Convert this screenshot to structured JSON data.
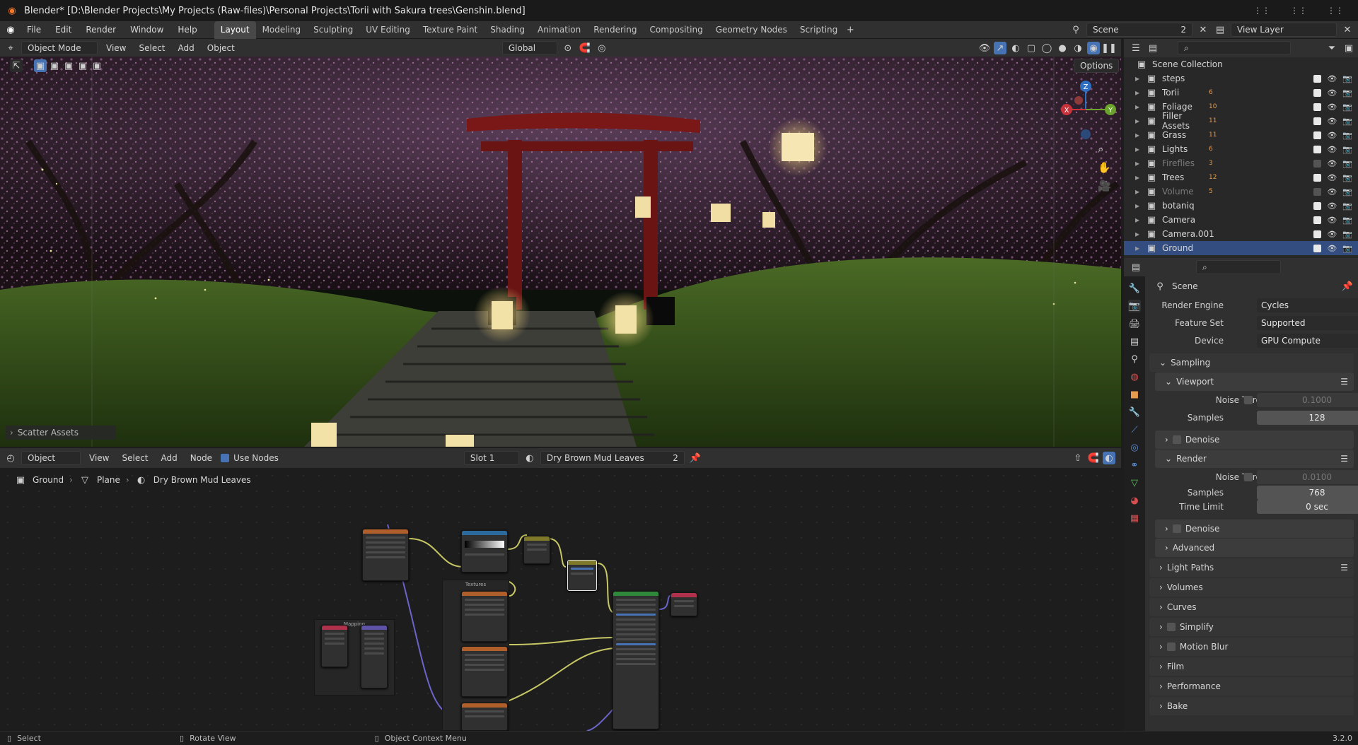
{
  "titlebar": {
    "title": "Blender* [D:\\Blender Projects\\My Projects (Raw-files)\\Personal Projects\\Torii with Sakura trees\\Genshin.blend]"
  },
  "menubar": {
    "items": [
      "File",
      "Edit",
      "Render",
      "Window",
      "Help"
    ]
  },
  "workspaces": [
    "Layout",
    "Modeling",
    "Sculpting",
    "UV Editing",
    "Texture Paint",
    "Shading",
    "Animation",
    "Rendering",
    "Compositing",
    "Geometry Nodes",
    "Scripting"
  ],
  "scene": {
    "label": "Scene",
    "users": "2",
    "view_layer": "View Layer"
  },
  "viewport_header": {
    "mode": "Object Mode",
    "menus": [
      "View",
      "Select",
      "Add",
      "Object"
    ],
    "orientation": "Global",
    "options": "Options"
  },
  "viewport": {
    "operator_panel": "Scatter Assets",
    "gizmo": {
      "z": "Z",
      "x": "X",
      "y": "Y"
    }
  },
  "node_header": {
    "editor": "Object",
    "menus": [
      "View",
      "Select",
      "Add",
      "Node"
    ],
    "use_nodes": "Use Nodes",
    "slot": "Slot 1",
    "material": "Dry Brown Mud Leaves",
    "material_users": "2"
  },
  "breadcrumb": {
    "object": "Ground",
    "mesh": "Plane",
    "material": "Dry Brown Mud Leaves"
  },
  "nodes": {
    "frame1": "Textures",
    "frame2": "Mapping"
  },
  "outliner": {
    "root": "Scene Collection",
    "items": [
      {
        "name": "steps",
        "dim": false,
        "badge": ""
      },
      {
        "name": "Torii",
        "dim": false,
        "badge": "6"
      },
      {
        "name": "Foliage",
        "dim": false,
        "badge": "10"
      },
      {
        "name": "Filler Assets",
        "dim": false,
        "badge": "11"
      },
      {
        "name": "Grass",
        "dim": false,
        "badge": "11"
      },
      {
        "name": "Lights",
        "dim": false,
        "badge": "6"
      },
      {
        "name": "Fireflies",
        "dim": true,
        "badge": "3"
      },
      {
        "name": "Trees",
        "dim": false,
        "badge": "12"
      },
      {
        "name": "Volume",
        "dim": true,
        "badge": "5"
      },
      {
        "name": "botaniq",
        "dim": false,
        "badge": ""
      },
      {
        "name": "Camera",
        "dim": false,
        "badge": ""
      },
      {
        "name": "Camera.001",
        "dim": false,
        "badge": ""
      },
      {
        "name": "Ground",
        "dim": false,
        "badge": ""
      }
    ]
  },
  "properties": {
    "context": "Scene",
    "render_engine": {
      "label": "Render Engine",
      "value": "Cycles"
    },
    "feature_set": {
      "label": "Feature Set",
      "value": "Supported"
    },
    "device": {
      "label": "Device",
      "value": "GPU Compute"
    },
    "sampling": {
      "label": "Sampling",
      "viewport": {
        "label": "Viewport",
        "noise_label": "Noise Threshold",
        "noise": "0.1000",
        "samples_label": "Samples",
        "samples": "128",
        "denoise": "Denoise"
      },
      "render": {
        "label": "Render",
        "noise_label": "Noise Threshold",
        "noise": "0.0100",
        "samples_label": "Samples",
        "samples": "768",
        "time_label": "Time Limit",
        "time": "0 sec",
        "denoise": "Denoise"
      },
      "advanced": "Advanced"
    },
    "sections": [
      "Light Paths",
      "Volumes",
      "Curves",
      "Simplify",
      "Motion Blur",
      "Film",
      "Performance",
      "Bake"
    ]
  },
  "statusbar": {
    "select": "Select",
    "rotate": "Rotate View",
    "context": "Object Context Menu",
    "version": "3.2.0"
  }
}
